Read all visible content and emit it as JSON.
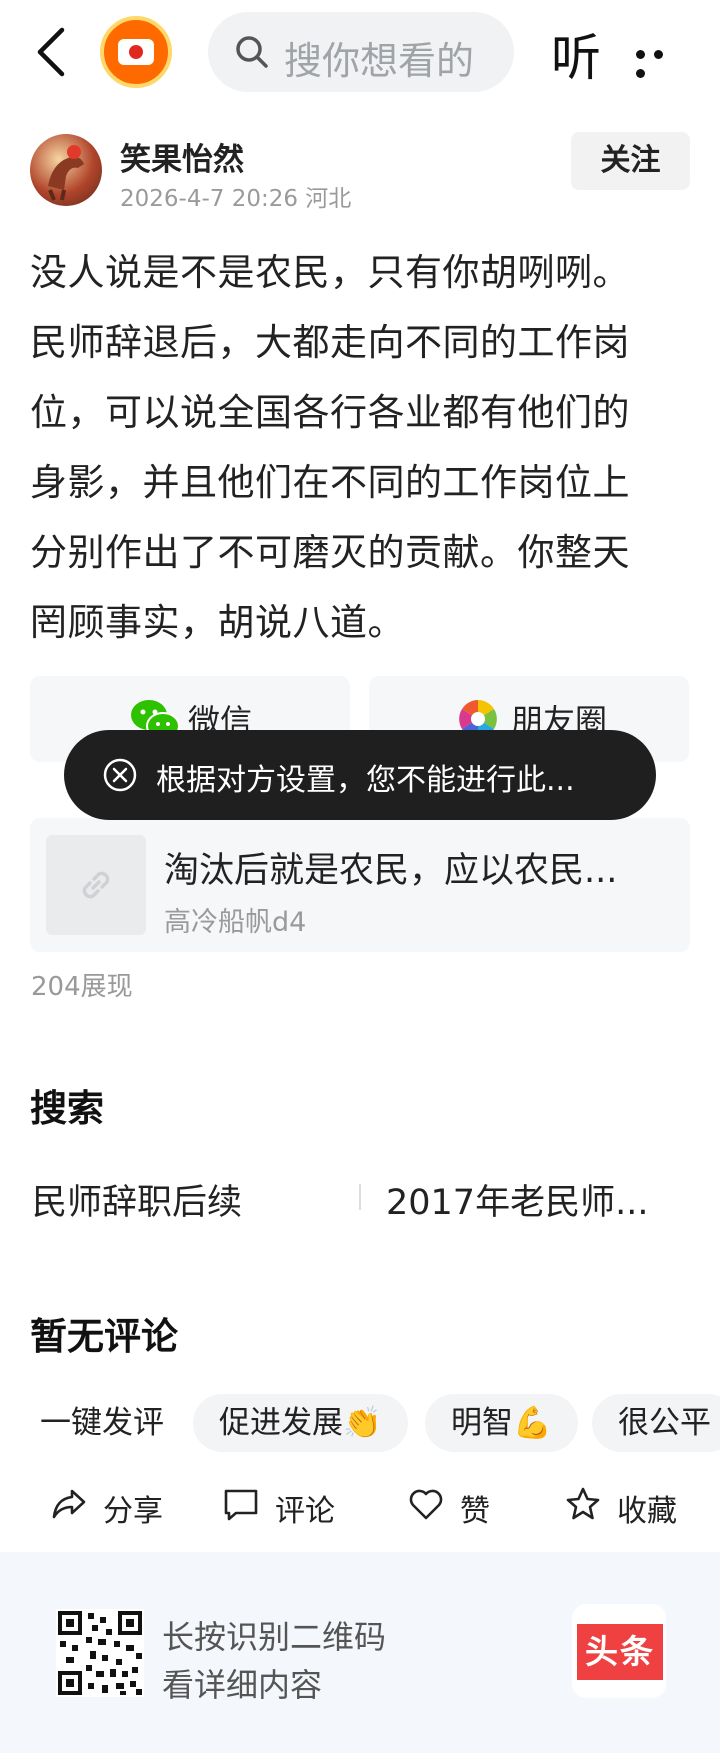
{
  "header": {
    "search_placeholder": "搜你想看的",
    "listen_label": "听"
  },
  "author": {
    "name": "笑果怡然",
    "meta": "2026-4-7 20:26 河北",
    "follow_label": "关注"
  },
  "post": {
    "lines": [
      "没人说是不是农民，只有你胡咧咧。",
      "民师辞退后，大都走向不同的工作岗",
      "位，可以说全国各行各业都有他们的",
      "身影，并且他们在不同的工作岗位上",
      "分别作出了不可磨灭的贡献。你整天",
      "罔顾事实，胡说八道。"
    ]
  },
  "share": {
    "wechat_label": "微信",
    "moments_label": "朋友圈"
  },
  "toast": {
    "message": "根据对方设置，您不能进行此..."
  },
  "quoted": {
    "title": "淘汰后就是农民，应以农民...",
    "author": "高冷船帆d4"
  },
  "views": "204展现",
  "search_section": {
    "title": "搜索",
    "items": [
      "民师辞职后续",
      "2017年老民师..."
    ]
  },
  "comments": {
    "title": "暂无评论",
    "quick_reply_label": "一键发评",
    "chips": [
      "促进发展👏",
      "明智💪",
      "很公平"
    ]
  },
  "actions": {
    "share": "分享",
    "comment": "评论",
    "like": "赞",
    "collect": "收藏"
  },
  "footer": {
    "line1": "长按识别二维码",
    "line2": "看详细内容",
    "logo_text": "头条"
  },
  "colors": {
    "toast_bg": "#1f1f1f",
    "logo_red": "#f04142",
    "chip_bg": "#f3f4f6"
  }
}
